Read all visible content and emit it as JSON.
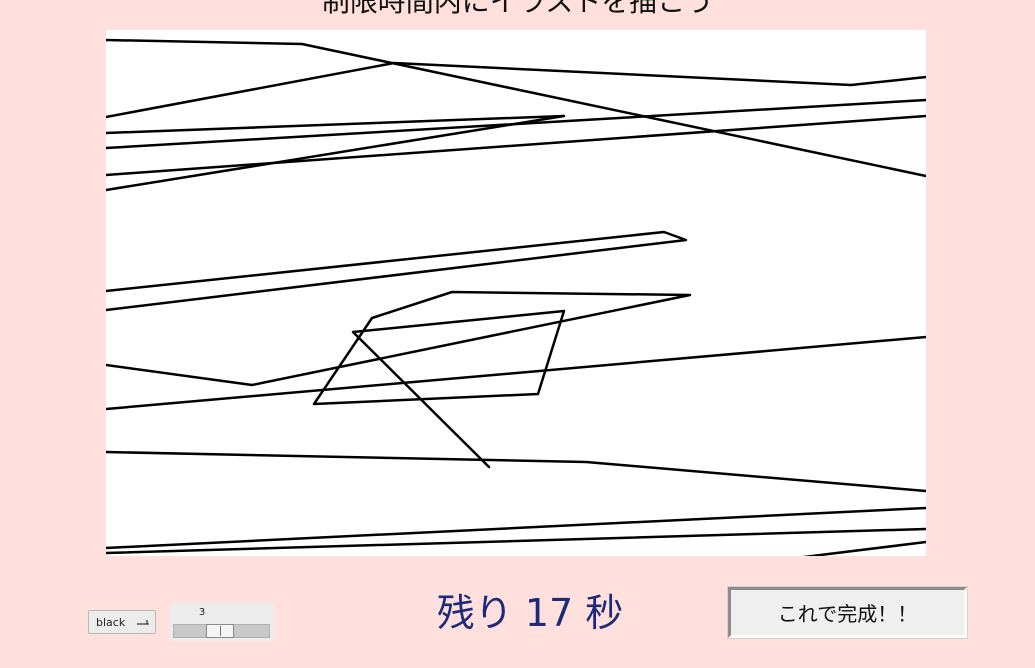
{
  "page": {
    "title": "制限時間内にイラストを描こう",
    "background_color": "#ffe0dc"
  },
  "canvas": {
    "background": "#ffffff",
    "stroke_color": "#000000"
  },
  "controls": {
    "color_select": {
      "selected": "black"
    },
    "line_width": {
      "value": "3",
      "min": 1,
      "max": 10
    },
    "timer": {
      "label": "残り 17 秒",
      "seconds_remaining": 17
    },
    "done_button": {
      "label": "これで完成！！"
    }
  },
  "colors": {
    "timer_text": "#1e2a7a",
    "button_face": "#efefef"
  }
}
